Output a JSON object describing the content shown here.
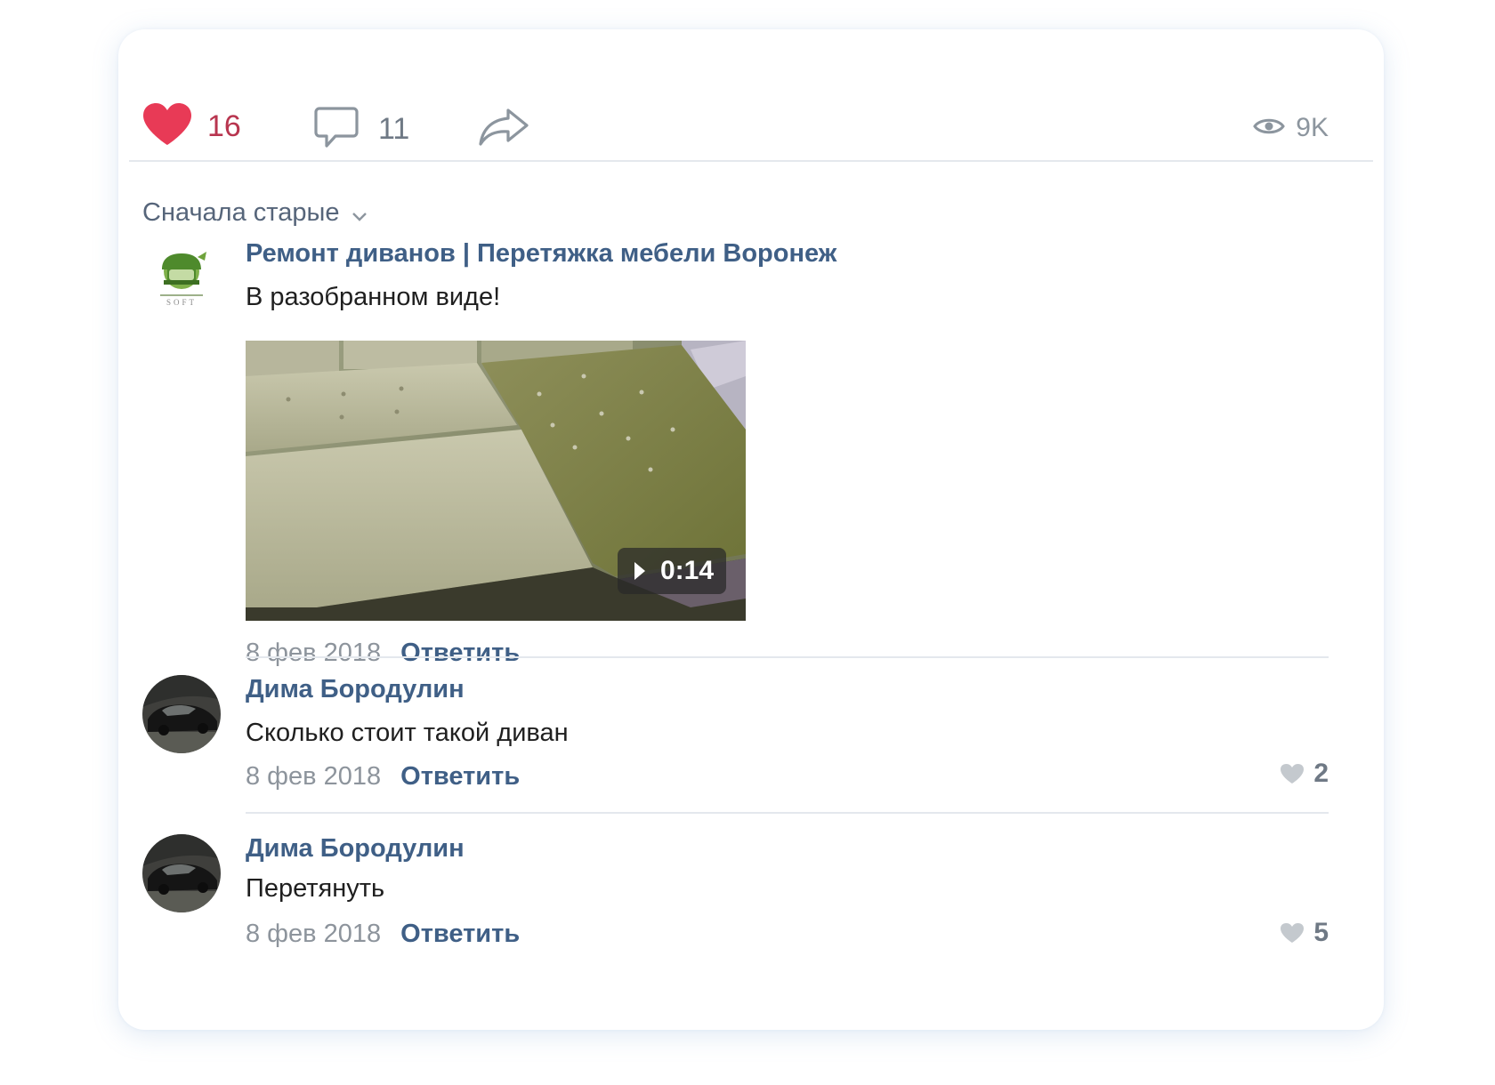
{
  "actions": {
    "likes": "16",
    "comments": "11",
    "views": "9K"
  },
  "sort": {
    "label": "Сначала старые"
  },
  "comments": [
    {
      "author": "Ремонт диванов | Перетяжка мебели Воронеж",
      "text": "В разобранном виде!",
      "video_duration": "0:14",
      "date": "8 фев 2018",
      "reply": "Ответить"
    },
    {
      "author": "Дима Бородулин",
      "text": "Сколько стоит такой диван",
      "date": "8 фев 2018",
      "reply": "Ответить",
      "likes": "2"
    },
    {
      "author": "Дима Бородулин",
      "text": "Перетянуть",
      "date": "8 фев 2018",
      "reply": "Ответить",
      "likes": "5"
    }
  ],
  "icons": {
    "like": "heart-icon",
    "comment": "comment-bubble-icon",
    "share": "share-arrow-icon",
    "views": "eye-icon",
    "sort": "chevron-down-icon",
    "play": "play-icon",
    "comment_like": "heart-icon"
  },
  "colors": {
    "like_active": "#e83a56",
    "link": "#3f5f86",
    "muted": "#8d949c"
  }
}
